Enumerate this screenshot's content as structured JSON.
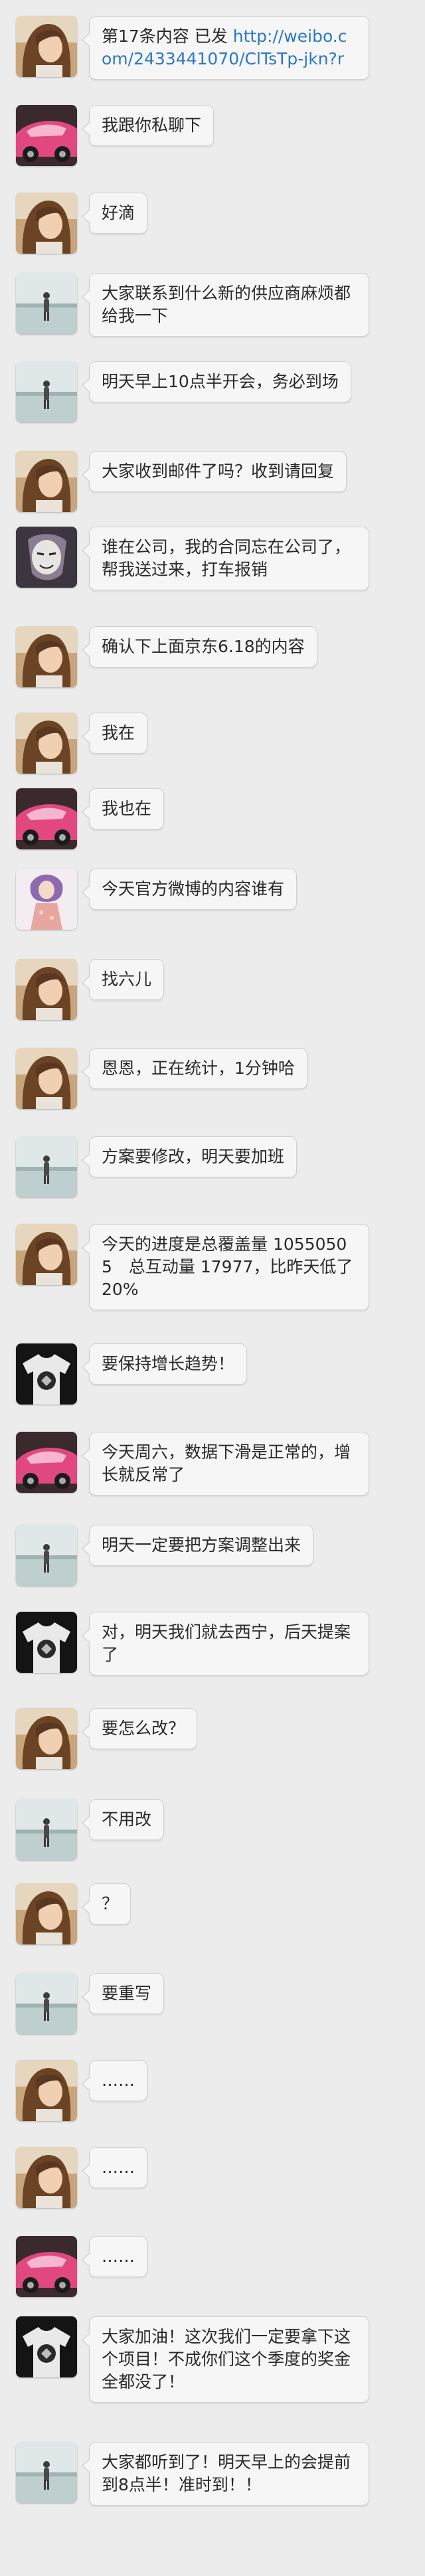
{
  "messages": [
    {
      "avatar": "girl-brown-hair-avatar",
      "text": "第17条内容 已发 ",
      "link": "http://weibo.com/2433441070/ClTsTp-jkn?r"
    },
    {
      "avatar": "pink-car-avatar",
      "text": "我跟你私聊下"
    },
    {
      "avatar": "girl-brown-hair-avatar",
      "text": "好滴"
    },
    {
      "avatar": "beach-figure-avatar",
      "text": "大家联系到什么新的供应商麻烦都给我一下"
    },
    {
      "avatar": "beach-figure-avatar",
      "text": "明天早上10点半开会，务必到场"
    },
    {
      "avatar": "girl-brown-hair-avatar",
      "text": "大家收到邮件了吗？收到请回复"
    },
    {
      "avatar": "masked-face-avatar",
      "text": "谁在公司，我的合同忘在公司了，帮我送过来，打车报销"
    },
    {
      "avatar": "girl-brown-hair-avatar",
      "text": "确认下上面京东6.18的内容"
    },
    {
      "avatar": "girl-brown-hair-avatar",
      "text": "我在"
    },
    {
      "avatar": "pink-car-avatar",
      "text": "我也在"
    },
    {
      "avatar": "purple-hair-girl-avatar",
      "text": "今天官方微博的内容谁有"
    },
    {
      "avatar": "girl-brown-hair-avatar",
      "text": "找六儿"
    },
    {
      "avatar": "girl-brown-hair-avatar",
      "text": "恩恩，正在统计，1分钟哈"
    },
    {
      "avatar": "beach-figure-avatar",
      "text": "方案要修改，明天要加班"
    },
    {
      "avatar": "girl-brown-hair-avatar",
      "text": "今天的进度是总覆盖量 10550505　总互动量 17977，比昨天低了20%"
    },
    {
      "avatar": "bw-shirt-avatar",
      "text": "要保持增长趋势！"
    },
    {
      "avatar": "pink-car-avatar",
      "text": "今天周六，数据下滑是正常的，增长就反常了"
    },
    {
      "avatar": "beach-figure-avatar",
      "text": "明天一定要把方案调整出来"
    },
    {
      "avatar": "bw-shirt-avatar",
      "text": "对，明天我们就去西宁，后天提案了"
    },
    {
      "avatar": "girl-brown-hair-avatar",
      "text": "要怎么改？"
    },
    {
      "avatar": "beach-figure-avatar",
      "text": "不用改"
    },
    {
      "avatar": "girl-brown-hair-avatar",
      "text": "？"
    },
    {
      "avatar": "beach-figure-avatar",
      "text": "要重写"
    },
    {
      "avatar": "girl-brown-hair-avatar",
      "text": "……"
    },
    {
      "avatar": "girl-brown-hair-avatar",
      "text": "……"
    },
    {
      "avatar": "pink-car-avatar",
      "text": "……"
    },
    {
      "avatar": "bw-shirt-avatar",
      "text": "大家加油！这次我们一定要拿下这个项目！不成你们这个季度的奖金全都没了！"
    },
    {
      "avatar": "beach-figure-avatar",
      "text": "大家都听到了！明天早上的会提前到8点半！准时到！！"
    }
  ]
}
